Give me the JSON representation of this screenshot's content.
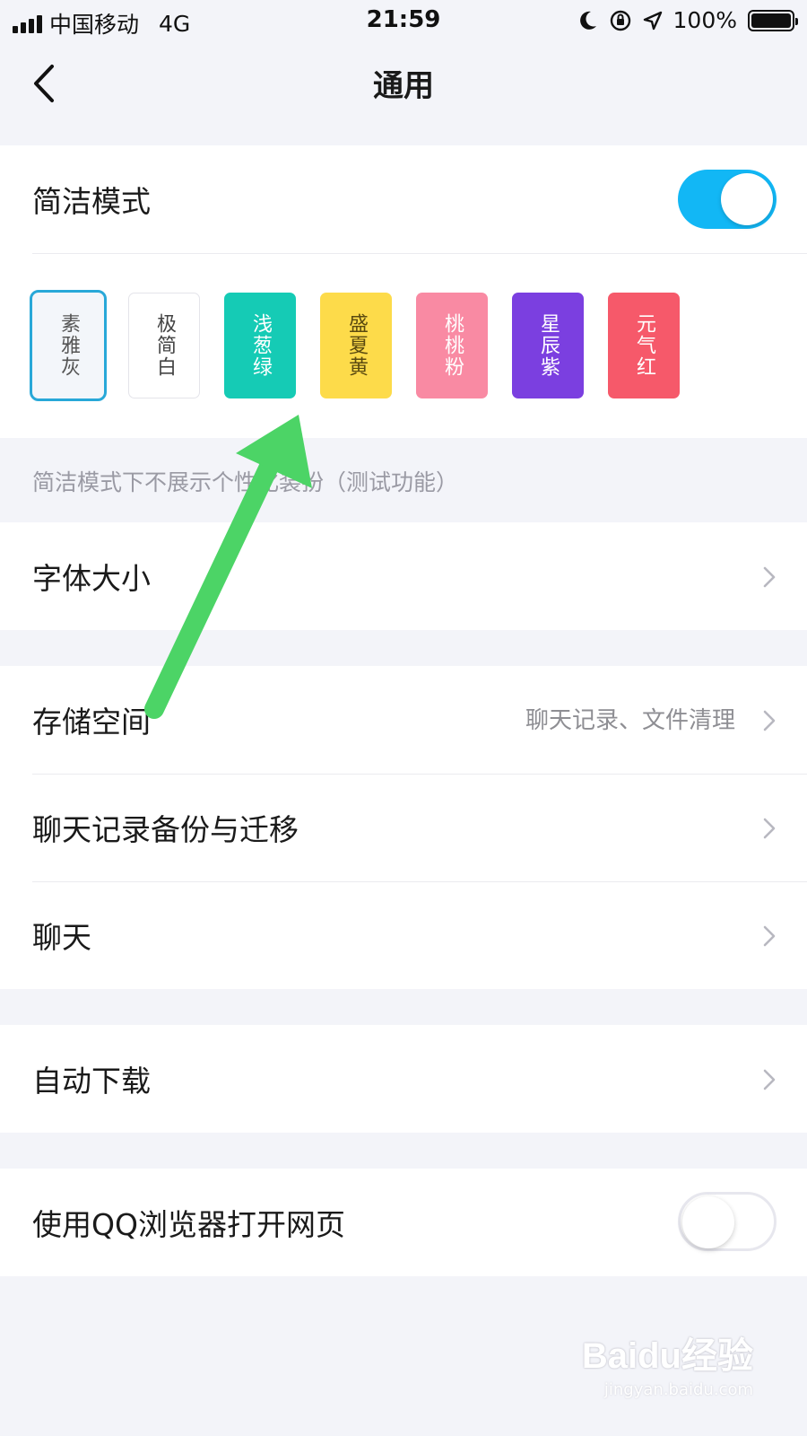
{
  "status": {
    "carrier": "中国移动",
    "network": "4G",
    "time": "21:59",
    "battery": "100%",
    "battery_level": 1.0
  },
  "nav": {
    "title": "通用"
  },
  "simple_mode": {
    "label": "简洁模式",
    "enabled": true
  },
  "themes": [
    {
      "label": "素雅灰",
      "bg": "#f3f6fa",
      "fg": "#555555",
      "selected": true
    },
    {
      "label": "极简白",
      "bg": "#ffffff",
      "fg": "#444444",
      "selected": false
    },
    {
      "label": "浅葱绿",
      "bg": "#15cbb5",
      "fg": "#ffffff",
      "selected": false
    },
    {
      "label": "盛夏黄",
      "bg": "#fddb4a",
      "fg": "#5a4a10",
      "selected": false
    },
    {
      "label": "桃桃粉",
      "bg": "#f98aa3",
      "fg": "#ffffff",
      "selected": false
    },
    {
      "label": "星辰紫",
      "bg": "#7b3fe0",
      "fg": "#ffffff",
      "selected": false
    },
    {
      "label": "元气红",
      "bg": "#f6596a",
      "fg": "#ffffff",
      "selected": false
    }
  ],
  "hint": "简洁模式下不展示个性化装扮（测试功能）",
  "font_size": {
    "label": "字体大小"
  },
  "storage": {
    "label": "存储空间",
    "sub": "聊天记录、文件清理"
  },
  "backup": {
    "label": "聊天记录备份与迁移"
  },
  "chat": {
    "label": "聊天"
  },
  "auto_download": {
    "label": "自动下载"
  },
  "qq_browser": {
    "label": "使用QQ浏览器打开网页",
    "enabled": false
  },
  "watermark": {
    "logo": "Baidu经验",
    "url": "jingyan.baidu.com"
  },
  "colors": {
    "accent": "#12b7f5",
    "arrow": "#4cd466"
  }
}
